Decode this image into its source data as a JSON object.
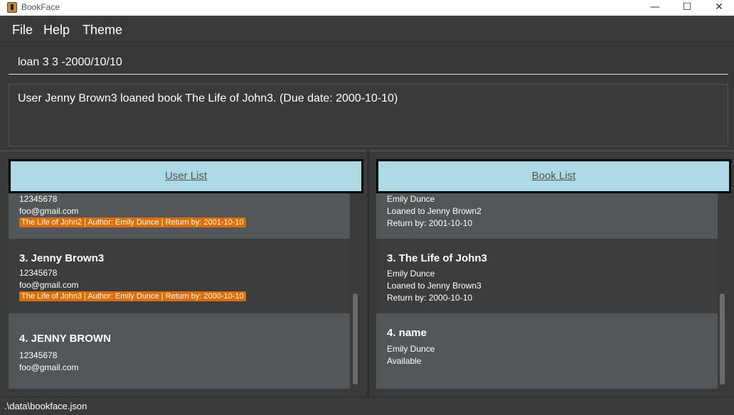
{
  "window": {
    "title": "BookFace",
    "minimize_glyph": "—",
    "maximize_glyph": "☐",
    "close_glyph": "✕"
  },
  "menu": [
    {
      "label": "File"
    },
    {
      "label": "Help"
    },
    {
      "label": "Theme"
    }
  ],
  "command": {
    "value": "loan 3 3 -2000/10/10"
  },
  "result": {
    "text": "User Jenny Brown3 loaned book The Life of John3. (Due date: 2000-10-10)"
  },
  "user_list": {
    "header": "User List",
    "cards": [
      {
        "phone": "12345678",
        "email": "foo@gmail.com",
        "tag": "The Life of John2 | Author: Emily Dunce | Return by: 2001-10-10"
      },
      {
        "title": "3.  Jenny Brown3",
        "phone": "12345678",
        "email": "foo@gmail.com",
        "tag": "The Life of John3 | Author: Emily Dunce | Return by: 2000-10-10"
      },
      {
        "title": "4.  JENNY BROWN",
        "phone": "12345678",
        "email": "foo@gmail.com"
      }
    ]
  },
  "book_list": {
    "header": "Book List",
    "cards": [
      {
        "author": "Emily Dunce",
        "loan": "Loaned to Jenny Brown2",
        "return": "Return by: 2001-10-10"
      },
      {
        "title": "3.  The Life of John3",
        "author": "Emily Dunce",
        "loan": "Loaned to Jenny Brown3",
        "return": "Return by: 2000-10-10"
      },
      {
        "title": "4.  name",
        "author": "Emily Dunce",
        "status": "Available"
      }
    ]
  },
  "status": {
    "path": ".\\data\\bookface.json"
  },
  "colors": {
    "background": "#3f3f3f",
    "header_accent": "#add8e6",
    "tag": "#d96e0a"
  }
}
